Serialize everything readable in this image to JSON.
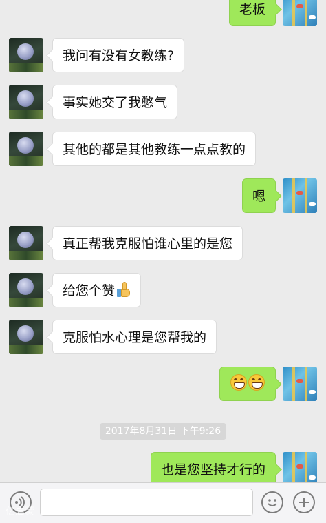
{
  "messages": [
    {
      "side": "right",
      "text": "老板"
    },
    {
      "side": "left",
      "text": "我问有没有女教练?"
    },
    {
      "side": "left",
      "text": "事实她交了我憋气"
    },
    {
      "side": "left",
      "text": "其他的都是其他教练一点点教的"
    },
    {
      "side": "right",
      "text": "嗯"
    },
    {
      "side": "left",
      "text": "真正帮我克服怕谁心里的是您"
    },
    {
      "side": "left",
      "text": "给您个赞",
      "icon": "thumbs-up-icon"
    },
    {
      "side": "left",
      "text": "克服怕水心理是您帮我的"
    },
    {
      "side": "right",
      "text": "",
      "icon": "grin-emoji-icon x2"
    },
    {
      "side": "right",
      "text": "也是您坚持才行的"
    }
  ],
  "timestamp": "2017年8月31日 下午9:26",
  "input": {
    "placeholder": "",
    "value": ""
  },
  "watermark": "亿启蒙"
}
